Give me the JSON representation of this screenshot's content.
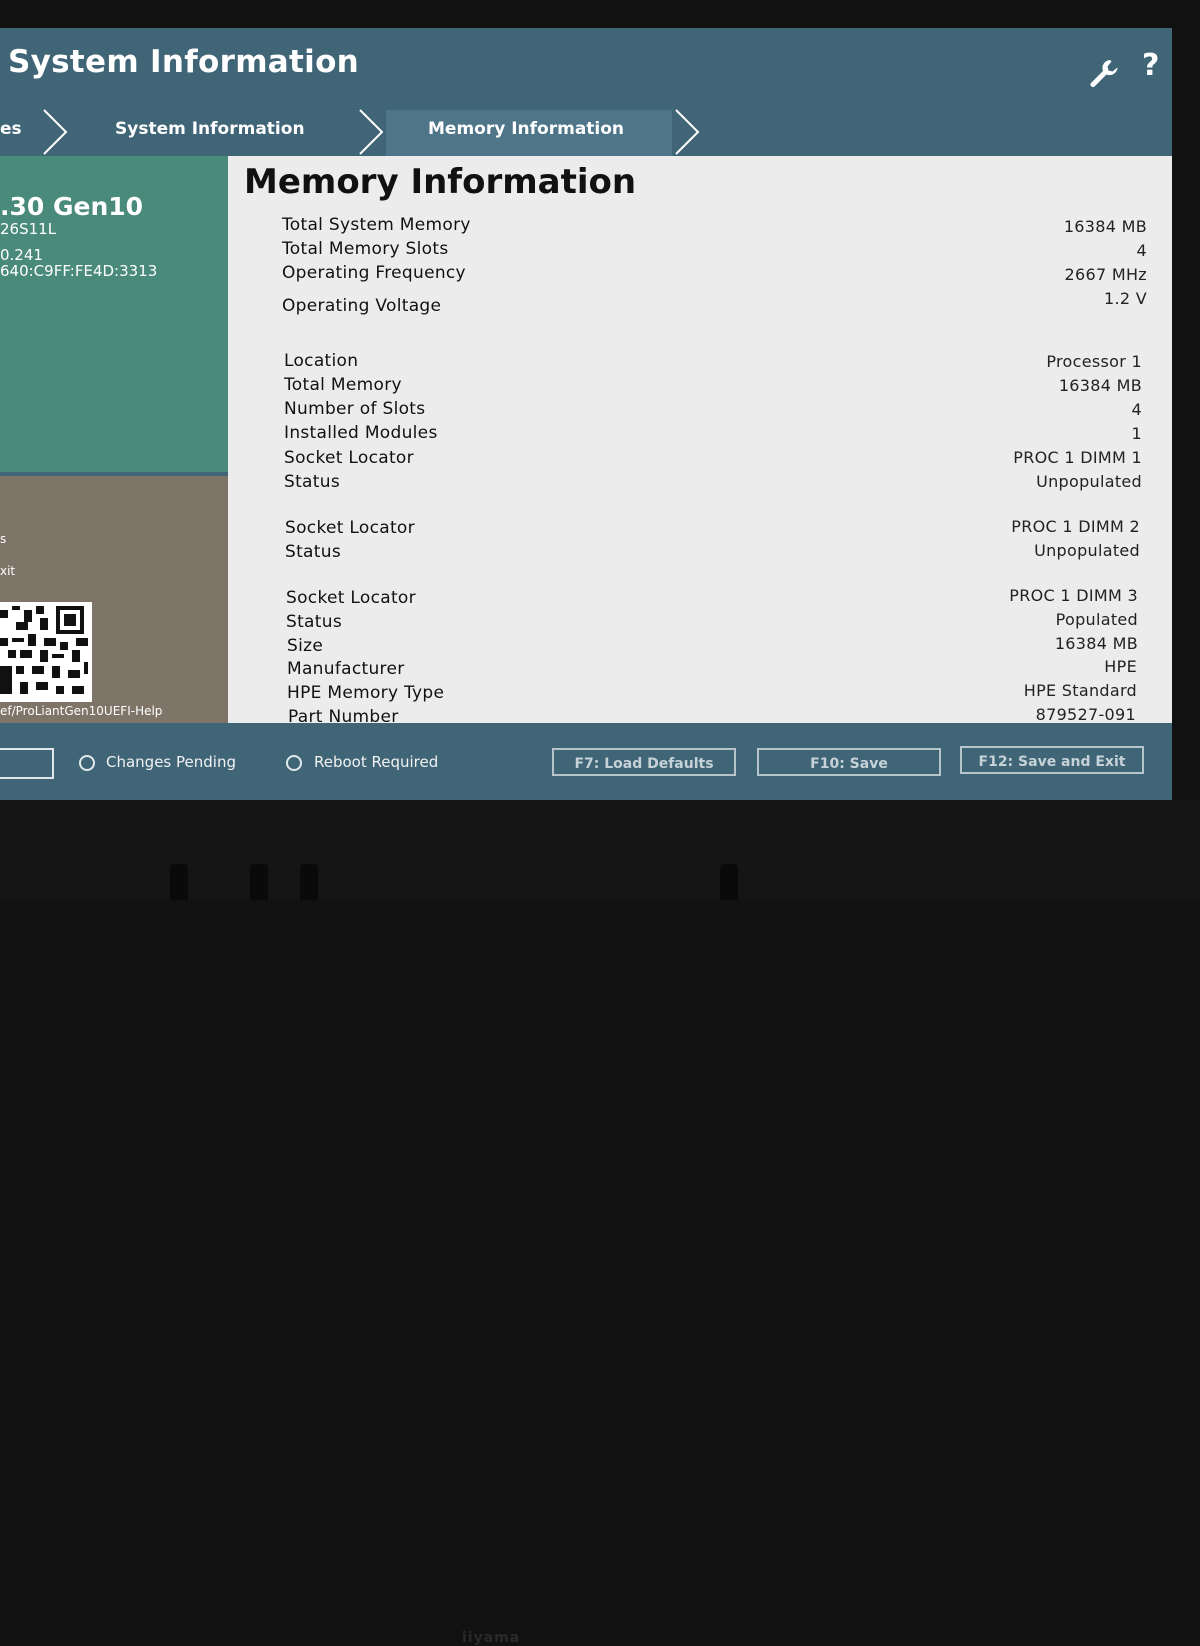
{
  "header": {
    "title": "System Information",
    "settings_icon": "wrench-icon",
    "help_label": "?"
  },
  "breadcrumb": [
    {
      "label": "es"
    },
    {
      "label": "System Information"
    },
    {
      "label": "Memory Information"
    }
  ],
  "left_panel": {
    "model": ".30 Gen10",
    "serial": "26S11L",
    "ipv4": "0.241",
    "ipv6": "640:C9FF:FE4D:3313",
    "menu_items": [
      "s",
      "xit"
    ],
    "help_url": "ef/ProLiantGen10UEFI-Help"
  },
  "main": {
    "title": "Memory Information",
    "summary": [
      {
        "label": "Total System Memory",
        "value": "16384 MB"
      },
      {
        "label": "Total Memory Slots",
        "value": "4"
      },
      {
        "label": "Operating Frequency",
        "value": "2667 MHz"
      },
      {
        "label": "Operating Voltage",
        "value": "1.2 V"
      }
    ],
    "processor": [
      {
        "label": "Location",
        "value": "Processor 1"
      },
      {
        "label": "Total Memory",
        "value": "16384 MB"
      },
      {
        "label": "Number of Slots",
        "value": "4"
      },
      {
        "label": "Installed Modules",
        "value": "1"
      },
      {
        "label": "Socket Locator",
        "value": "PROC 1 DIMM 1"
      },
      {
        "label": "Status",
        "value": "Unpopulated"
      }
    ],
    "dimm2": [
      {
        "label": "Socket Locator",
        "value": "PROC 1 DIMM 2"
      },
      {
        "label": "Status",
        "value": "Unpopulated"
      }
    ],
    "dimm3": [
      {
        "label": "Socket Locator",
        "value": "PROC 1 DIMM 3"
      },
      {
        "label": "Status",
        "value": "Populated"
      },
      {
        "label": "Size",
        "value": "16384 MB"
      },
      {
        "label": "Manufacturer",
        "value": "HPE"
      },
      {
        "label": "HPE Memory Type",
        "value": "HPE Standard"
      },
      {
        "label": "Part Number",
        "value": "879527-091"
      }
    ]
  },
  "footer": {
    "changes_pending": "Changes Pending",
    "reboot_required": "Reboot Required",
    "load_defaults": "F7: Load Defaults",
    "save": "F10: Save",
    "save_exit": "F12: Save and Exit"
  },
  "monitor": {
    "brand": "iiyama"
  },
  "colors": {
    "header_bg": "#3f6577",
    "left_green": "#4a8a7a",
    "left_brown": "#7e7467",
    "content_bg": "#ececec"
  }
}
